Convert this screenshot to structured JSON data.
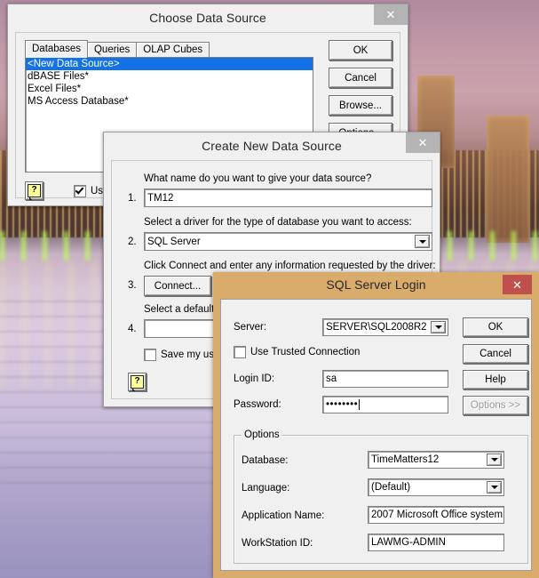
{
  "desktop": {
    "wallpaper_description": "city skyline at dusk reflected on water"
  },
  "choose_data_source": {
    "title": "Choose Data Source",
    "close_label": "✕",
    "tabs": [
      {
        "label": "Databases",
        "active": true
      },
      {
        "label": "Queries",
        "active": false
      },
      {
        "label": "OLAP Cubes",
        "active": false
      }
    ],
    "list_items": [
      {
        "label": "<New Data Source>",
        "selected": true
      },
      {
        "label": "dBASE Files*",
        "selected": false
      },
      {
        "label": "Excel Files*",
        "selected": false
      },
      {
        "label": "MS Access Database*",
        "selected": false
      }
    ],
    "buttons": {
      "ok": "OK",
      "cancel": "Cancel",
      "browse": "Browse...",
      "options": "Options..."
    },
    "help_glyph": "?",
    "use_checkbox": {
      "label": "Use",
      "checked": true
    }
  },
  "create_new_data_source": {
    "title": "Create New Data Source",
    "close_label": "✕",
    "step1": {
      "number": "1.",
      "question": "What name do you want to give your data source?",
      "value": "TM12"
    },
    "step2": {
      "number": "2.",
      "question": "Select a driver for the type of database you want to access:",
      "value": "SQL Server"
    },
    "step3": {
      "number": "3.",
      "question": "Click Connect and enter any information requested by the driver:",
      "button_label": "Connect..."
    },
    "step4": {
      "number": "4.",
      "question": "Select a default ta",
      "value": ""
    },
    "save_checkbox": {
      "label": "Save my user",
      "checked": false
    },
    "help_glyph": "?"
  },
  "sql_server_login": {
    "title": "SQL Server Login",
    "close_label": "✕",
    "titlebar_color": "#d9ac6b",
    "close_color": "#c0504d",
    "fields": {
      "server": {
        "label": "Server:",
        "value": "SERVER\\SQL2008R2"
      },
      "trusted": {
        "label": "Use Trusted Connection",
        "checked": false
      },
      "login_id": {
        "label": "Login ID:",
        "value": "sa"
      },
      "password": {
        "label": "Password:",
        "value": "••••••••"
      }
    },
    "buttons": {
      "ok": "OK",
      "cancel": "Cancel",
      "help": "Help",
      "options": "Options >>",
      "options_disabled": true
    },
    "options_group": {
      "legend": "Options",
      "rows": [
        {
          "label": "Database:",
          "value": "TimeMatters12",
          "type": "combo"
        },
        {
          "label": "Language:",
          "value": "(Default)",
          "type": "combo"
        },
        {
          "label": "Application Name:",
          "value": "2007 Microsoft Office system",
          "type": "text"
        },
        {
          "label": "WorkStation ID:",
          "value": "LAWMG-ADMIN",
          "type": "text"
        }
      ]
    }
  }
}
